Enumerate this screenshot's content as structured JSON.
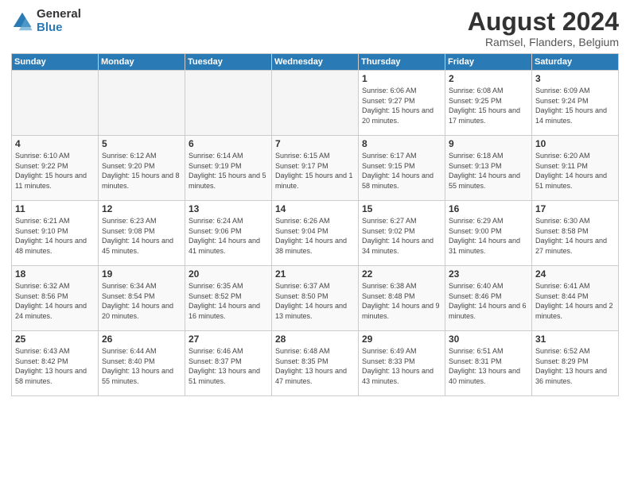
{
  "header": {
    "logo_general": "General",
    "logo_blue": "Blue",
    "main_title": "August 2024",
    "subtitle": "Ramsel, Flanders, Belgium"
  },
  "days_of_week": [
    "Sunday",
    "Monday",
    "Tuesday",
    "Wednesday",
    "Thursday",
    "Friday",
    "Saturday"
  ],
  "weeks": [
    [
      {
        "day": "",
        "empty": true
      },
      {
        "day": "",
        "empty": true
      },
      {
        "day": "",
        "empty": true
      },
      {
        "day": "",
        "empty": true
      },
      {
        "day": "1",
        "sunrise": "6:06 AM",
        "sunset": "9:27 PM",
        "daylight": "15 hours and 20 minutes."
      },
      {
        "day": "2",
        "sunrise": "6:08 AM",
        "sunset": "9:25 PM",
        "daylight": "15 hours and 17 minutes."
      },
      {
        "day": "3",
        "sunrise": "6:09 AM",
        "sunset": "9:24 PM",
        "daylight": "15 hours and 14 minutes."
      }
    ],
    [
      {
        "day": "4",
        "sunrise": "6:10 AM",
        "sunset": "9:22 PM",
        "daylight": "15 hours and 11 minutes."
      },
      {
        "day": "5",
        "sunrise": "6:12 AM",
        "sunset": "9:20 PM",
        "daylight": "15 hours and 8 minutes."
      },
      {
        "day": "6",
        "sunrise": "6:14 AM",
        "sunset": "9:19 PM",
        "daylight": "15 hours and 5 minutes."
      },
      {
        "day": "7",
        "sunrise": "6:15 AM",
        "sunset": "9:17 PM",
        "daylight": "15 hours and 1 minute."
      },
      {
        "day": "8",
        "sunrise": "6:17 AM",
        "sunset": "9:15 PM",
        "daylight": "14 hours and 58 minutes."
      },
      {
        "day": "9",
        "sunrise": "6:18 AM",
        "sunset": "9:13 PM",
        "daylight": "14 hours and 55 minutes."
      },
      {
        "day": "10",
        "sunrise": "6:20 AM",
        "sunset": "9:11 PM",
        "daylight": "14 hours and 51 minutes."
      }
    ],
    [
      {
        "day": "11",
        "sunrise": "6:21 AM",
        "sunset": "9:10 PM",
        "daylight": "14 hours and 48 minutes."
      },
      {
        "day": "12",
        "sunrise": "6:23 AM",
        "sunset": "9:08 PM",
        "daylight": "14 hours and 45 minutes."
      },
      {
        "day": "13",
        "sunrise": "6:24 AM",
        "sunset": "9:06 PM",
        "daylight": "14 hours and 41 minutes."
      },
      {
        "day": "14",
        "sunrise": "6:26 AM",
        "sunset": "9:04 PM",
        "daylight": "14 hours and 38 minutes."
      },
      {
        "day": "15",
        "sunrise": "6:27 AM",
        "sunset": "9:02 PM",
        "daylight": "14 hours and 34 minutes."
      },
      {
        "day": "16",
        "sunrise": "6:29 AM",
        "sunset": "9:00 PM",
        "daylight": "14 hours and 31 minutes."
      },
      {
        "day": "17",
        "sunrise": "6:30 AM",
        "sunset": "8:58 PM",
        "daylight": "14 hours and 27 minutes."
      }
    ],
    [
      {
        "day": "18",
        "sunrise": "6:32 AM",
        "sunset": "8:56 PM",
        "daylight": "14 hours and 24 minutes."
      },
      {
        "day": "19",
        "sunrise": "6:34 AM",
        "sunset": "8:54 PM",
        "daylight": "14 hours and 20 minutes."
      },
      {
        "day": "20",
        "sunrise": "6:35 AM",
        "sunset": "8:52 PM",
        "daylight": "14 hours and 16 minutes."
      },
      {
        "day": "21",
        "sunrise": "6:37 AM",
        "sunset": "8:50 PM",
        "daylight": "14 hours and 13 minutes."
      },
      {
        "day": "22",
        "sunrise": "6:38 AM",
        "sunset": "8:48 PM",
        "daylight": "14 hours and 9 minutes."
      },
      {
        "day": "23",
        "sunrise": "6:40 AM",
        "sunset": "8:46 PM",
        "daylight": "14 hours and 6 minutes."
      },
      {
        "day": "24",
        "sunrise": "6:41 AM",
        "sunset": "8:44 PM",
        "daylight": "14 hours and 2 minutes."
      }
    ],
    [
      {
        "day": "25",
        "sunrise": "6:43 AM",
        "sunset": "8:42 PM",
        "daylight": "13 hours and 58 minutes."
      },
      {
        "day": "26",
        "sunrise": "6:44 AM",
        "sunset": "8:40 PM",
        "daylight": "13 hours and 55 minutes."
      },
      {
        "day": "27",
        "sunrise": "6:46 AM",
        "sunset": "8:37 PM",
        "daylight": "13 hours and 51 minutes."
      },
      {
        "day": "28",
        "sunrise": "6:48 AM",
        "sunset": "8:35 PM",
        "daylight": "13 hours and 47 minutes."
      },
      {
        "day": "29",
        "sunrise": "6:49 AM",
        "sunset": "8:33 PM",
        "daylight": "13 hours and 43 minutes."
      },
      {
        "day": "30",
        "sunrise": "6:51 AM",
        "sunset": "8:31 PM",
        "daylight": "13 hours and 40 minutes."
      },
      {
        "day": "31",
        "sunrise": "6:52 AM",
        "sunset": "8:29 PM",
        "daylight": "13 hours and 36 minutes."
      }
    ]
  ]
}
